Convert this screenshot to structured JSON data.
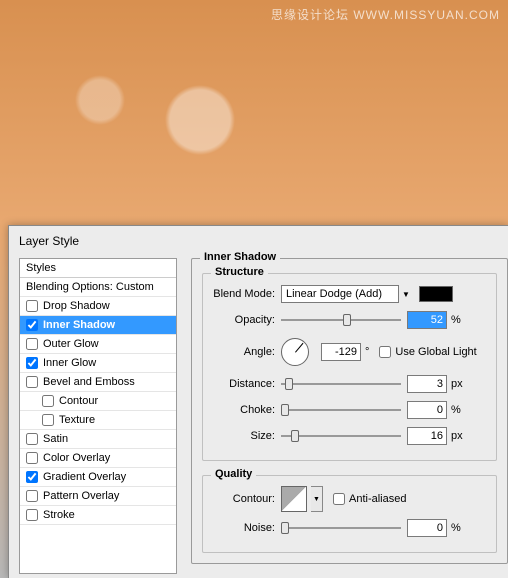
{
  "watermark": "思缘设计论坛  WWW.MISSYUAN.COM",
  "dialog": {
    "title": "Layer Style",
    "styles_header": "Styles",
    "blending": "Blending Options: Custom",
    "items": [
      {
        "label": "Drop Shadow",
        "checked": false,
        "selected": false
      },
      {
        "label": "Inner Shadow",
        "checked": true,
        "selected": true
      },
      {
        "label": "Outer Glow",
        "checked": false,
        "selected": false
      },
      {
        "label": "Inner Glow",
        "checked": true,
        "selected": false
      },
      {
        "label": "Bevel and Emboss",
        "checked": false,
        "selected": false
      },
      {
        "label": "Contour",
        "checked": false,
        "selected": false,
        "indent": true
      },
      {
        "label": "Texture",
        "checked": false,
        "selected": false,
        "indent": true
      },
      {
        "label": "Satin",
        "checked": false,
        "selected": false
      },
      {
        "label": "Color Overlay",
        "checked": false,
        "selected": false
      },
      {
        "label": "Gradient Overlay",
        "checked": true,
        "selected": false
      },
      {
        "label": "Pattern Overlay",
        "checked": false,
        "selected": false
      },
      {
        "label": "Stroke",
        "checked": false,
        "selected": false
      }
    ]
  },
  "panel": {
    "title": "Inner Shadow",
    "structure": {
      "title": "Structure",
      "blend_mode_label": "Blend Mode:",
      "blend_mode_value": "Linear Dodge (Add)",
      "color": "#000000",
      "opacity_label": "Opacity:",
      "opacity_value": "52",
      "opacity_unit": "%",
      "angle_label": "Angle:",
      "angle_value": "-129",
      "angle_unit": "°",
      "global_light_label": "Use Global Light",
      "distance_label": "Distance:",
      "distance_value": "3",
      "distance_unit": "px",
      "choke_label": "Choke:",
      "choke_value": "0",
      "choke_unit": "%",
      "size_label": "Size:",
      "size_value": "16",
      "size_unit": "px"
    },
    "quality": {
      "title": "Quality",
      "contour_label": "Contour:",
      "antialiased_label": "Anti-aliased",
      "noise_label": "Noise:",
      "noise_value": "0",
      "noise_unit": "%"
    }
  }
}
